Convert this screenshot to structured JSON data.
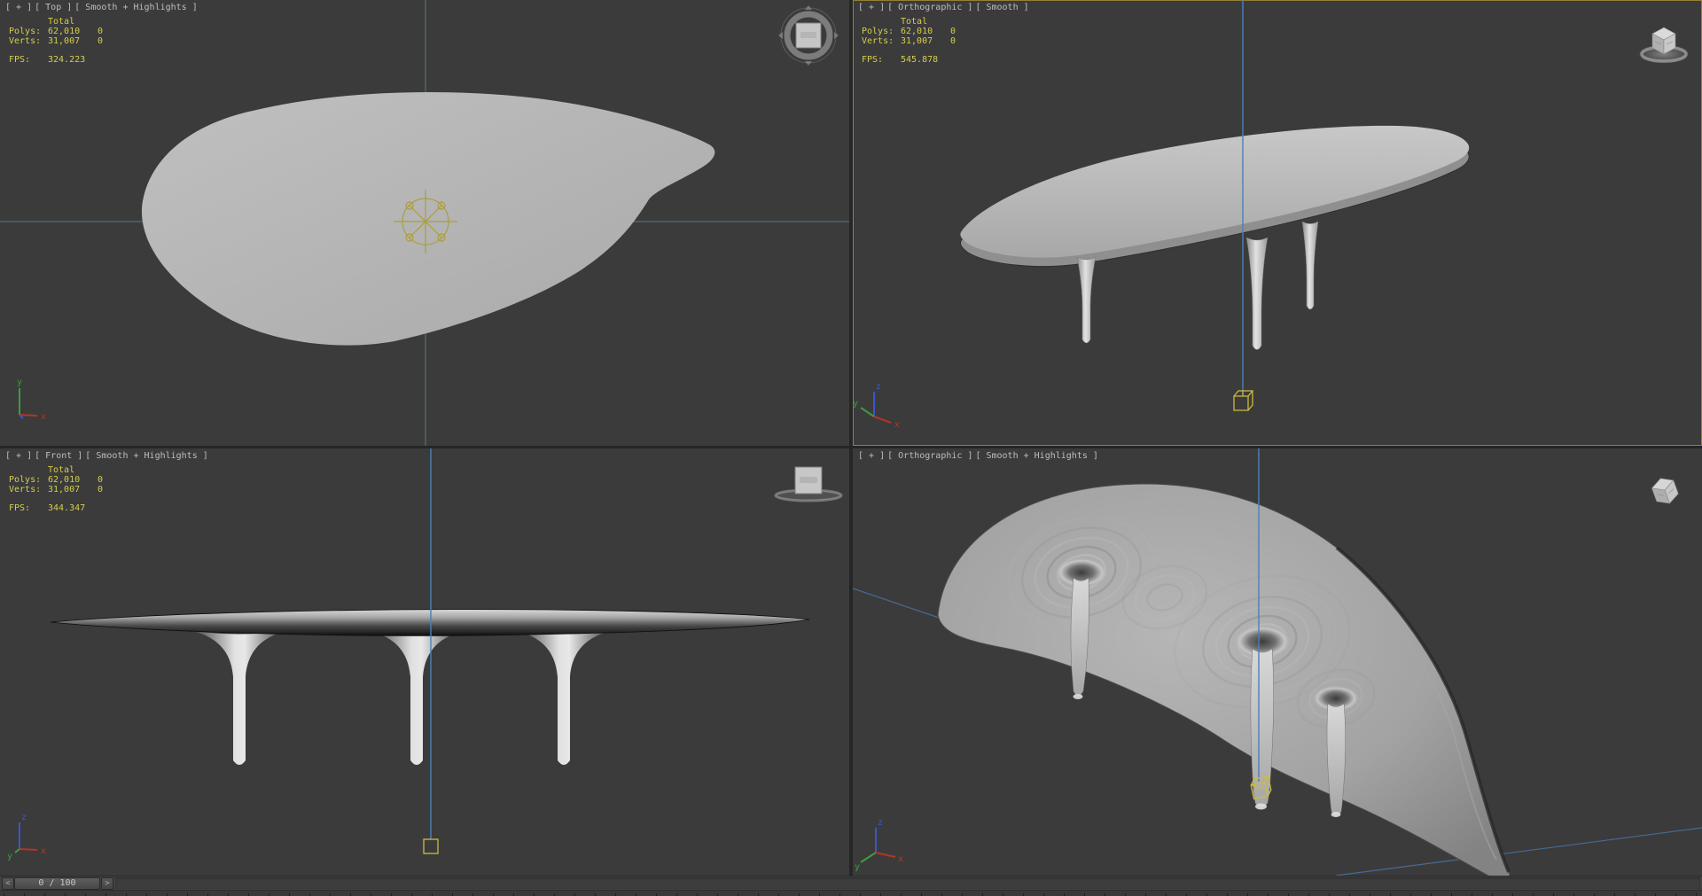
{
  "colors": {
    "viewport_bg": "#3b3b3b",
    "chrome_bg": "#262626",
    "active_viewport_border": "#94813b",
    "viewport_label_text": "#bdbdbd",
    "stats_text": "#d5cd4f",
    "grid_axis_line": "#4e626b",
    "object_line_blue": "#4a80bd",
    "selection_yellow": "#cdbc3e",
    "model_gray": "#b2b2b2",
    "axis_x_red": "#b23527",
    "axis_y_green": "#3e9b3e",
    "axis_z_blue": "#3d56c8"
  },
  "viewports": [
    {
      "menus": {
        "general": "[ + ]",
        "pov": "[ Top ]",
        "shading": "[ Smooth + Highlights ]"
      },
      "stats": {
        "total_label": "Total",
        "polys_label": "Polys:",
        "polys_value": "62,010",
        "polys_delta": "0",
        "verts_label": "Verts:",
        "verts_value": "31,007",
        "verts_delta": "0",
        "fps_label": "FPS:",
        "fps_value": "324.223"
      }
    },
    {
      "menus": {
        "general": "[ + ]",
        "pov": "[ Orthographic ]",
        "shading": "[ Smooth ]"
      },
      "stats": {
        "total_label": "Total",
        "polys_label": "Polys:",
        "polys_value": "62,010",
        "polys_delta": "0",
        "verts_label": "Verts:",
        "verts_value": "31,007",
        "verts_delta": "0",
        "fps_label": "FPS:",
        "fps_value": "545.878"
      }
    },
    {
      "menus": {
        "general": "[ + ]",
        "pov": "[ Front ]",
        "shading": "[ Smooth + Highlights ]"
      },
      "stats": {
        "total_label": "Total",
        "polys_label": "Polys:",
        "polys_value": "62,010",
        "polys_delta": "0",
        "verts_label": "Verts:",
        "verts_value": "31,007",
        "verts_delta": "0",
        "fps_label": "FPS:",
        "fps_value": "344.347"
      }
    },
    {
      "menus": {
        "general": "[ + ]",
        "pov": "[ Orthographic ]",
        "shading": "[ Smooth + Highlights ]"
      }
    }
  ],
  "timeline": {
    "prev_label": "<",
    "frame_display": "0 / 100",
    "next_label": ">"
  },
  "axes": {
    "x": "x",
    "y": "y",
    "z": "z"
  }
}
